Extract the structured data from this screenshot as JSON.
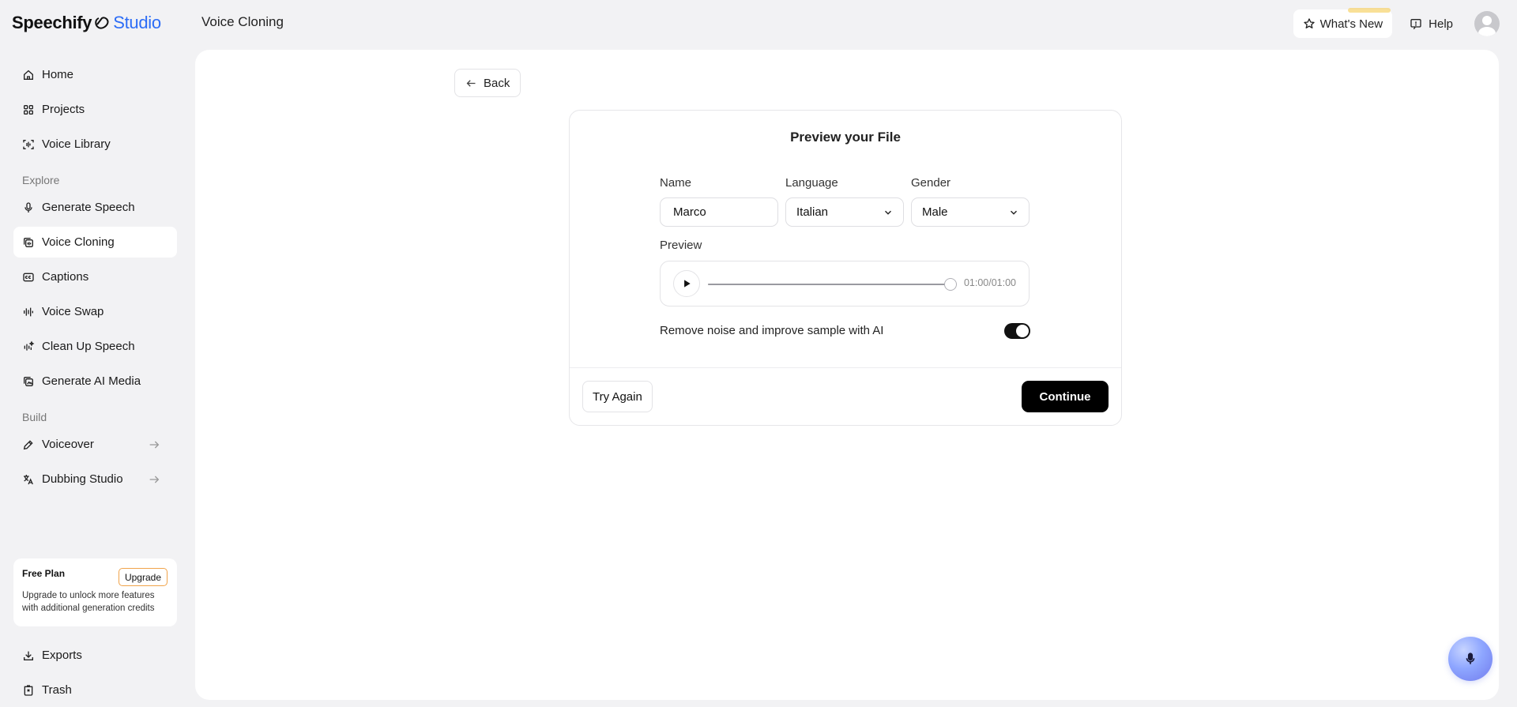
{
  "app": {
    "logo_brand": "Speechify",
    "logo_studio": "Studio",
    "page_title": "Voice Cloning"
  },
  "topbar": {
    "whats_new_label": "What's New",
    "help_label": "Help"
  },
  "sidebar": {
    "items": [
      {
        "label": "Home",
        "icon": "home-icon"
      },
      {
        "label": "Projects",
        "icon": "grid-icon"
      },
      {
        "label": "Voice Library",
        "icon": "voice-library-icon"
      },
      {
        "label": "Generate Speech",
        "icon": "microphone-icon"
      },
      {
        "label": "Voice Cloning",
        "icon": "voice-cloning-icon",
        "active": true
      },
      {
        "label": "Captions",
        "icon": "captions-icon"
      },
      {
        "label": "Voice Swap",
        "icon": "waveform-icon"
      },
      {
        "label": "Clean Up Speech",
        "icon": "sparkle-wave-icon"
      },
      {
        "label": "Generate AI Media",
        "icon": "media-icon"
      },
      {
        "label": "Voiceover",
        "icon": "pen-icon"
      },
      {
        "label": "Dubbing Studio",
        "icon": "translate-icon"
      },
      {
        "label": "Exports",
        "icon": "download-icon"
      },
      {
        "label": "Trash",
        "icon": "trash-icon"
      }
    ],
    "section_explore": "Explore",
    "section_build": "Build"
  },
  "plan": {
    "title": "Free Plan",
    "upgrade_label": "Upgrade",
    "description": "Upgrade to unlock more features with additional generation credits"
  },
  "main": {
    "back_label": "Back",
    "card_title": "Preview your File",
    "name_label": "Name",
    "name_value": "Marco",
    "language_label": "Language",
    "language_value": "Italian",
    "gender_label": "Gender",
    "gender_value": "Male",
    "preview_label": "Preview",
    "player_time": "01:00/01:00",
    "player_progress": 1.0,
    "noise_label": "Remove noise and improve sample with AI",
    "noise_enabled": true,
    "try_again_label": "Try Again",
    "continue_label": "Continue"
  },
  "colors": {
    "accent_blue": "#2d6df6",
    "upgrade_border": "#f0a34a",
    "primary_button": "#000000"
  }
}
